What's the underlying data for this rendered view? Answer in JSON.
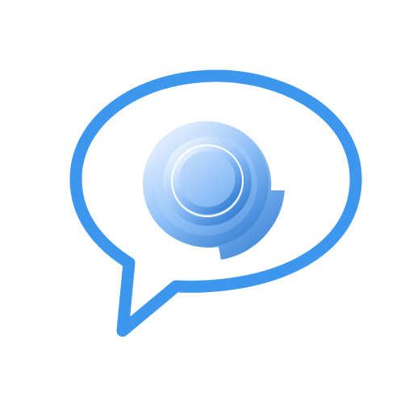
{
  "logo": {
    "name": "speech-bubble-with-spiral-logo",
    "icon": "chat-bubble-spiral-icon",
    "colors": {
      "background": "#ffffff",
      "bubble_outline": "#3d97ef",
      "spiral_light": "#dbeafe",
      "spiral_mid": "#8fc0f7",
      "spiral_dark": "#3b84d6"
    }
  }
}
